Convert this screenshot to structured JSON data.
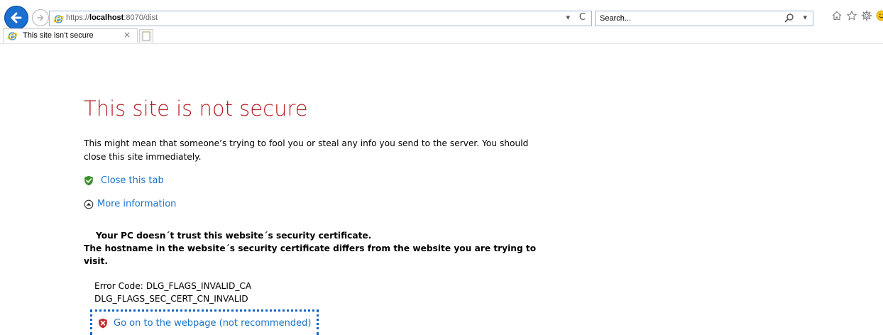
{
  "browser": {
    "url_prefix": "https://",
    "url_host": "localhost",
    "url_path": ":8070/dist",
    "url_dropdown": "▾",
    "refresh_glyph": "C",
    "search_placeholder": "Search...",
    "search_dropdown": "▾",
    "icons": [
      "back-arrow-icon",
      "forward-arrow-icon",
      "ie-logo-icon",
      "search-icon",
      "home-icon",
      "favorites-star-icon",
      "settings-gear-icon",
      "smiley-feedback-icon"
    ],
    "accent_color": "#1a6fd0"
  },
  "tab": {
    "title": "This site isn’t secure",
    "close_glyph": "×"
  },
  "page": {
    "title": "This site is not secure",
    "description": "This might mean that someone’s trying to fool you or steal any info you send to the server. You should close this site immediately.",
    "close_tab_label": "Close this tab",
    "more_info_label": "More information",
    "trust_line1": "Your PC doesn´t trust this website´s security certificate.",
    "trust_line2": "The hostname in the website´s security certificate differs from the website you are trying to visit.",
    "error_code_line1": "Error Code: DLG_FLAGS_INVALID_CA",
    "error_code_line2": "DLG_FLAGS_SEC_CERT_CN_INVALID",
    "go_on_label": "Go on to the webpage (not recommended)",
    "title_color": "#b81d23",
    "link_color": "#1a73c9"
  }
}
